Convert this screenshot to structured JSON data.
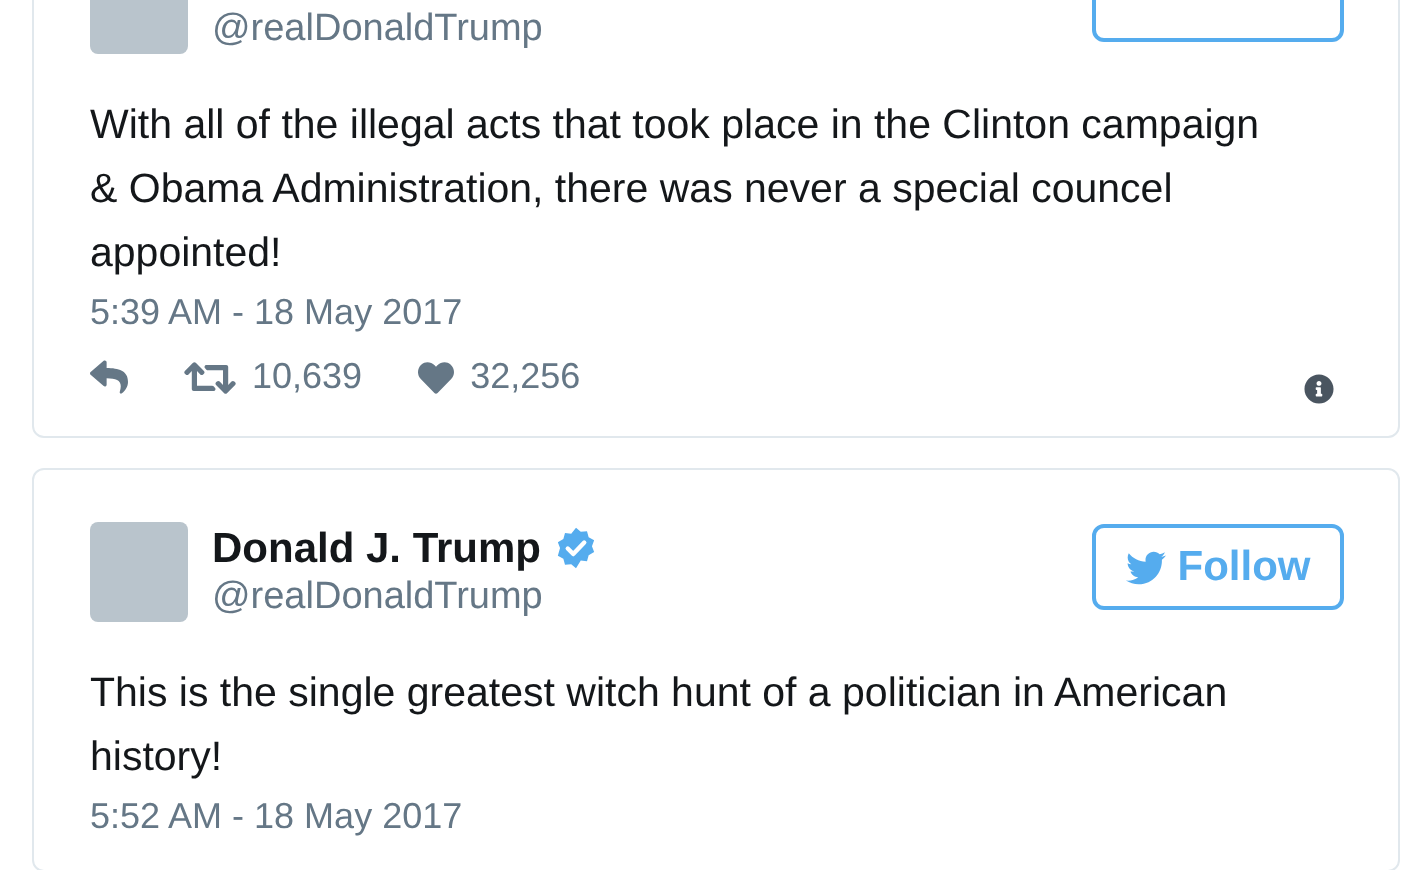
{
  "tweets": [
    {
      "handle": "@realDonaldTrump",
      "follow_button": true,
      "text": "With all of the illegal acts that took place in the Clinton campaign & Obama Administration, there was never a special councel appointed!",
      "time": "5:39 AM - 18 May 2017",
      "retweets": "10,639",
      "likes": "32,256"
    },
    {
      "name": "Donald J. Trump",
      "verified": true,
      "handle": "@realDonaldTrump",
      "follow_button": true,
      "follow_label": "Follow",
      "text": "This is the single greatest witch hunt of a politician in American history!",
      "time": "5:52 AM - 18 May 2017"
    }
  ]
}
